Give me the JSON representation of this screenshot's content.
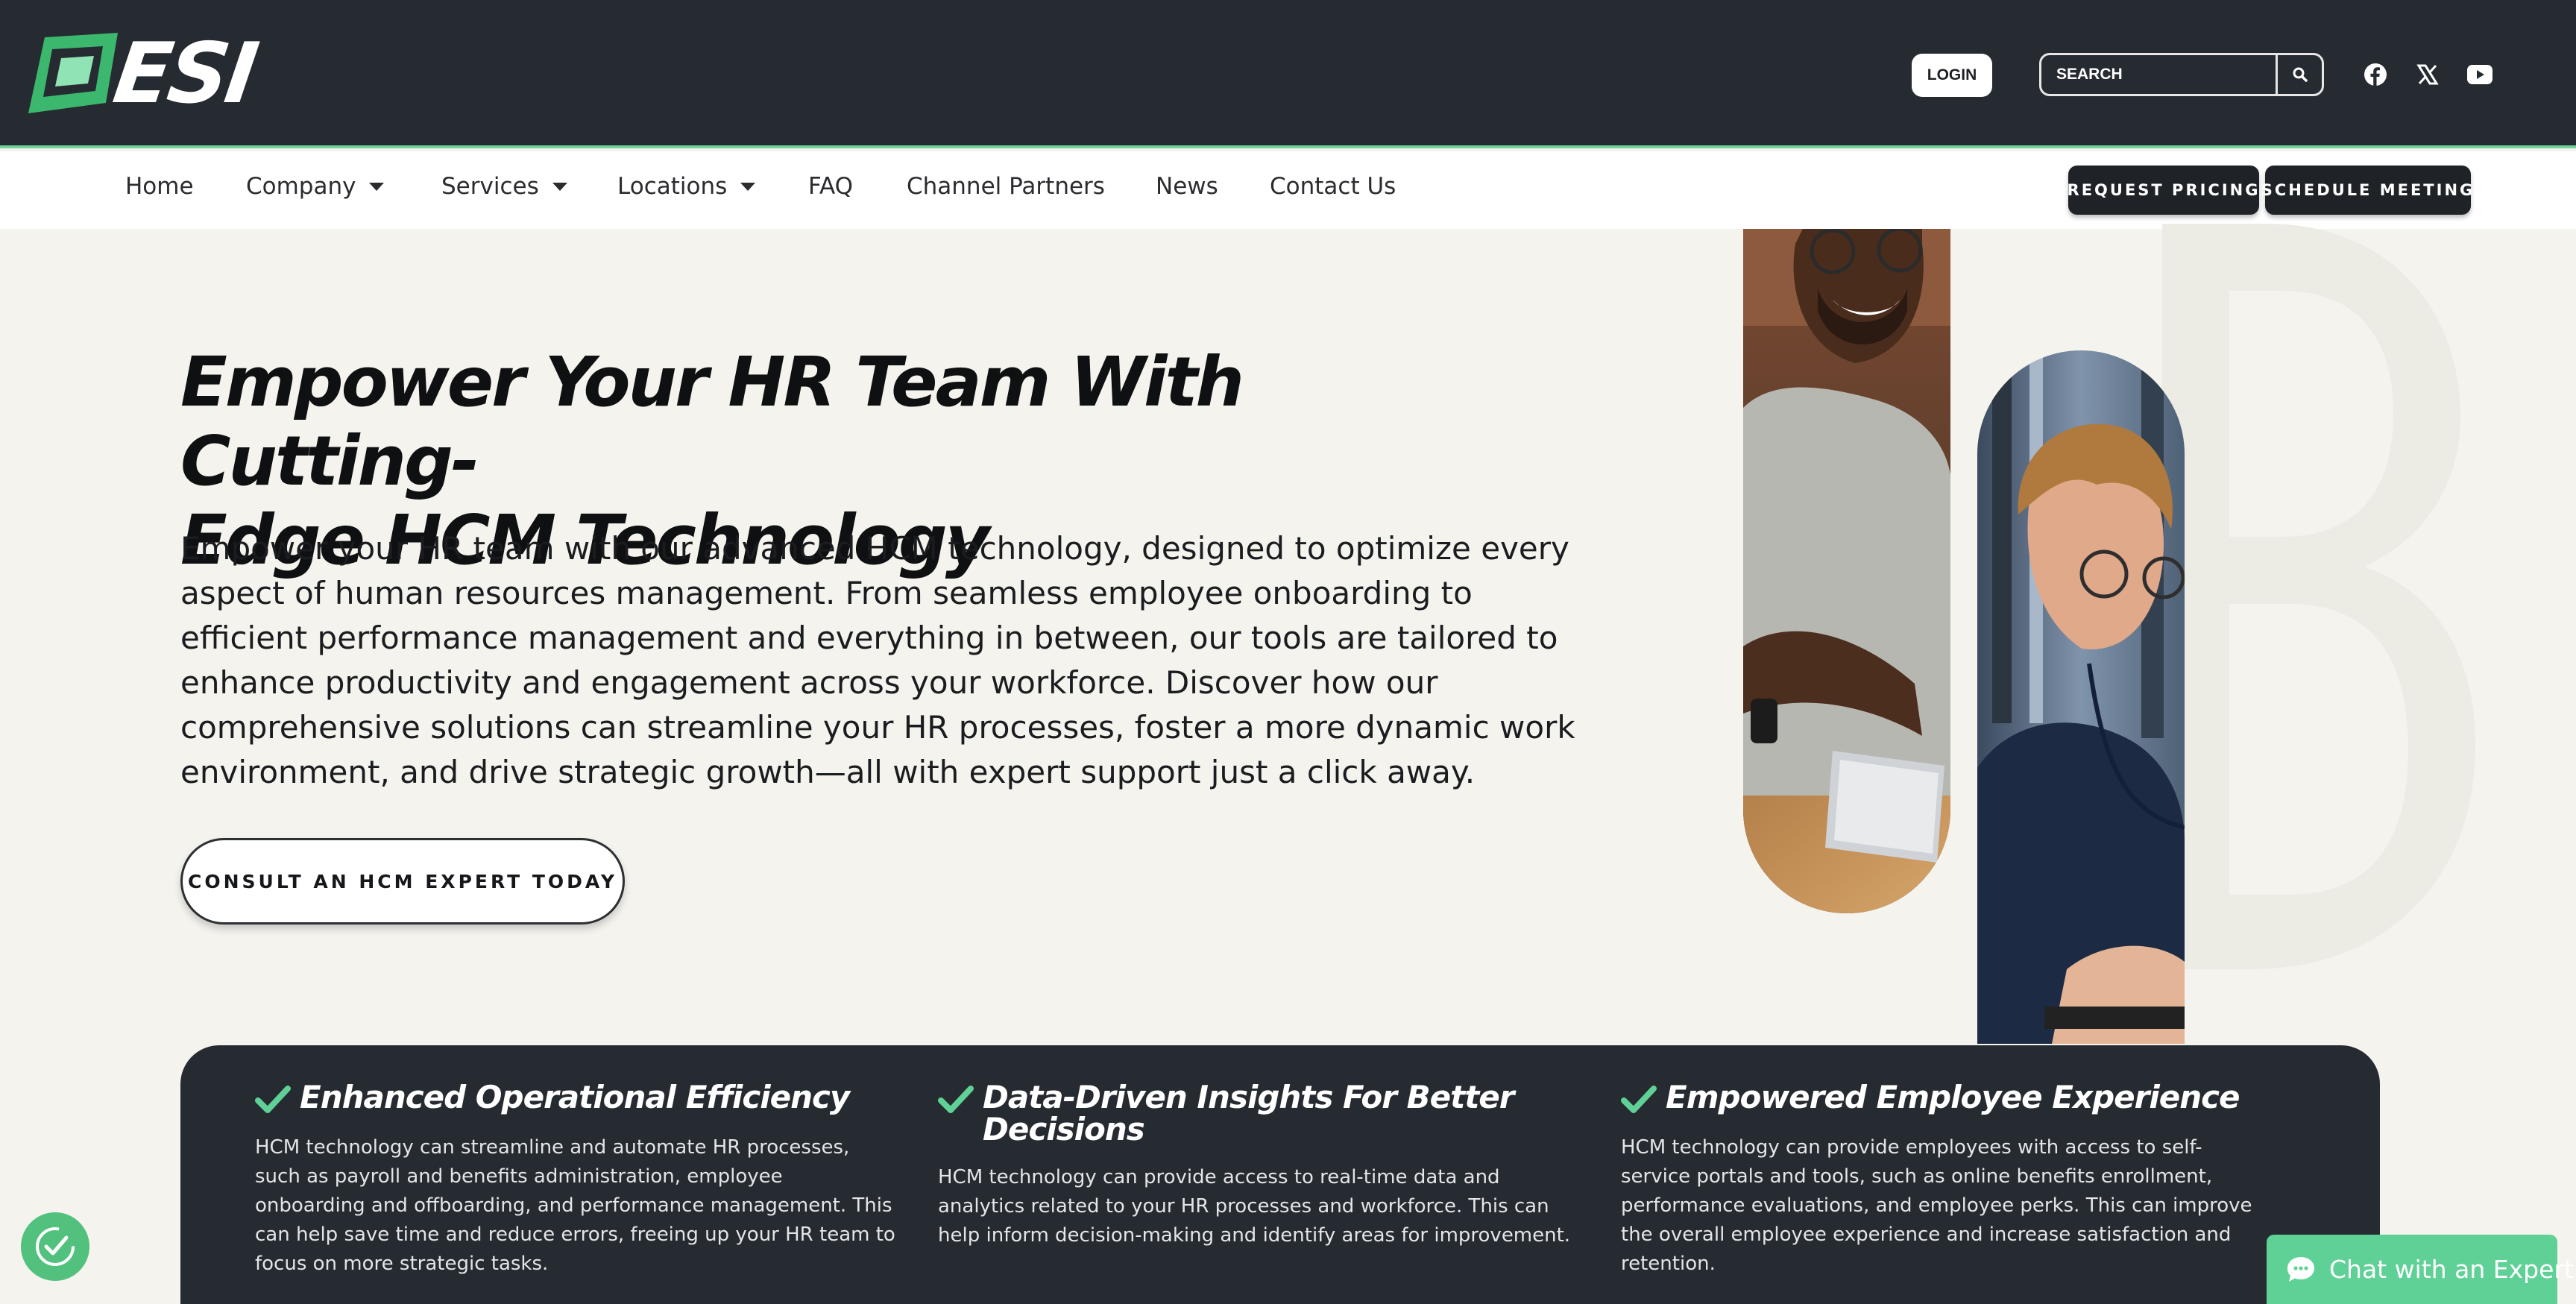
{
  "header": {
    "logo_text": "ESI",
    "login_label": "LOGIN",
    "search": {
      "placeholder": "SEARCH"
    },
    "social_icons": [
      "facebook-icon",
      "x-twitter-icon",
      "youtube-icon"
    ]
  },
  "nav": {
    "items": [
      {
        "label": "Home"
      },
      {
        "label": "Company",
        "dropdown": true
      },
      {
        "label": "Services",
        "dropdown": true
      },
      {
        "label": "Locations",
        "dropdown": true
      },
      {
        "label": "FAQ"
      },
      {
        "label": "Channel Partners"
      },
      {
        "label": "News"
      },
      {
        "label": "Contact Us"
      }
    ],
    "request_pricing": "REQUEST PRICING",
    "schedule_meeting": "SCHEDULE MEETING"
  },
  "hero": {
    "title_line1": "Empower Your HR Team With Cutting-",
    "title_line2": "Edge HCM Technology",
    "text": "Empower your HR team with our advanced HCM technology, designed to optimize every aspect of human resources management. From seamless employee onboarding to efficient performance management and everything in between, our tools are tailored to enhance productivity and engagement across your workforce. Discover how our comprehensive solutions can streamline your HR processes, foster a more dynamic work environment, and drive strategic growth—all with expert support just a click away.",
    "cta": "CONSULT AN HCM EXPERT TODAY"
  },
  "features": [
    {
      "title": "Enhanced Operational Efficiency",
      "text": "HCM technology can streamline and automate HR processes, such as payroll and benefits administration, employee onboarding and offboarding, and performance management. This can help save time and reduce errors, freeing up your HR team to focus on more strategic tasks."
    },
    {
      "title": "Data-Driven Insights For Better Decisions",
      "text": "HCM technology can provide access to real-time data and analytics related to your HR processes and workforce. This can help inform decision-making and identify areas for improvement."
    },
    {
      "title": "Empowered Employee Experience",
      "text": "HCM technology can provide employees with access to self-service portals and tools, such as online benefits enrollment, performance evaluations, and employee perks. This can improve the overall employee experience and increase satisfaction and retention."
    }
  ],
  "chat": {
    "label": "Chat with an Expert"
  },
  "colors": {
    "header_bg": "#262a31",
    "accent_green": "#5fd196",
    "page_bg": "#f4f3ee"
  }
}
